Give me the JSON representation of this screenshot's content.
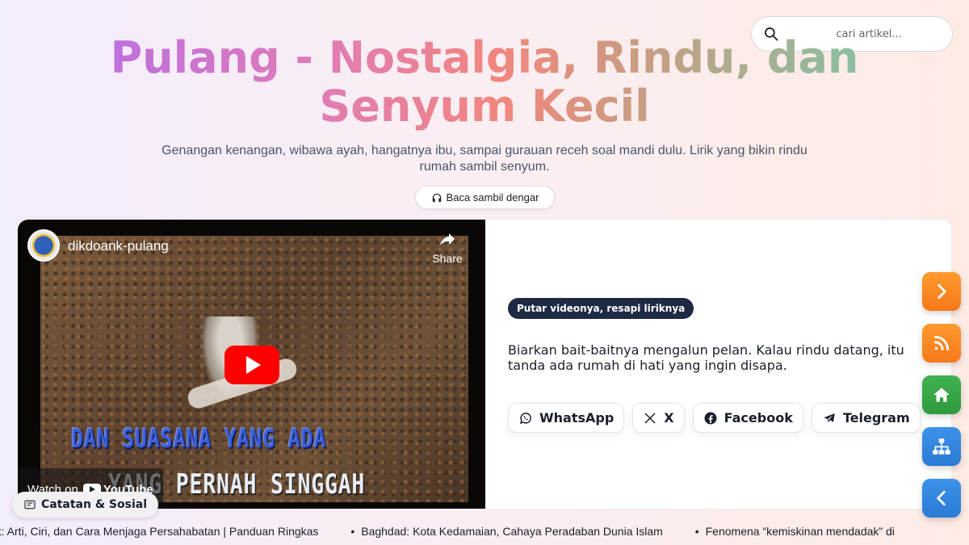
{
  "search": {
    "placeholder": "cari artikel..."
  },
  "hero": {
    "title": "Pulang - Nostalgia, Rindu, dan Senyum Kecil",
    "subtitle": "Genangan kenangan, wibawa ayah, hangatnya ibu, sampai gurauan receh soal mandi dulu. Lirik yang bikin rindu rumah sambil senyum.",
    "listen_label": "Baca sambil dengar",
    "listen_icon": "headphones-icon"
  },
  "video": {
    "channel_name": "dikdoank-pulang",
    "share_label": "Share",
    "lyric_line_1": "DAN SUASANA YANG ADA",
    "lyric_line_2": "YANG PERNAH SINGGAH ~~",
    "watch_on_label": "Watch on",
    "youtube_label": "YouTube"
  },
  "panel": {
    "tag": "Putar videonya, resapi liriknya",
    "description": "Biarkan bait-baitnya mengalun pelan. Kalau rindu datang, itu tanda ada rumah di hati yang ingin disapa.",
    "share_buttons": [
      {
        "label": "WhatsApp",
        "icon": "whatsapp-icon"
      },
      {
        "label": "X",
        "icon": "x-icon"
      },
      {
        "label": "Facebook",
        "icon": "facebook-icon"
      },
      {
        "label": "Telegram",
        "icon": "telegram-icon"
      }
    ]
  },
  "floating_nav": [
    "next-icon",
    "rss-icon",
    "home-icon",
    "sitemap-icon",
    "prev-icon"
  ],
  "section_pill": {
    "icon": "newspaper-icon",
    "label": "Catatan & Sosial"
  },
  "ticker": [
    "at: Arti, Ciri, dan Cara Menjaga Persahabatan | Panduan Ringkas",
    "Baghdad: Kota Kedamaian, Cahaya Peradaban Dunia Islam",
    "Fenomena “kemiskinan mendadak” di"
  ],
  "colors": {
    "accent_orange": "#f7791a",
    "accent_green": "#2e9a3e",
    "accent_blue": "#2a7ad6",
    "tag_bg": "#1e2a44",
    "youtube_red": "#ff0000"
  }
}
